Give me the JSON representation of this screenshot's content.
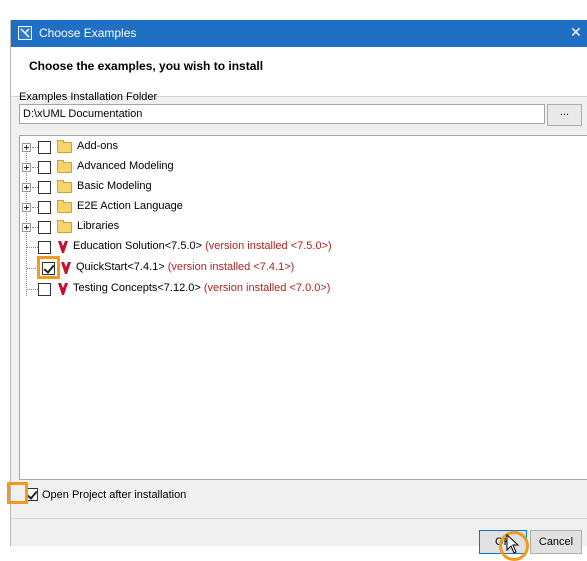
{
  "window": {
    "title": "Choose Examples",
    "close_glyph": "✕",
    "heading": "Choose the examples, you wish to install"
  },
  "folder": {
    "label": "Examples Installation Folder",
    "value": "D:\\xUML Documentation",
    "browse_label": "..."
  },
  "tree": {
    "items": [
      {
        "label": "Add-ons",
        "type": "folder",
        "checked": false,
        "expandable": true
      },
      {
        "label": "Advanced Modeling",
        "type": "folder",
        "checked": false,
        "expandable": true
      },
      {
        "label": "Basic Modeling",
        "type": "folder",
        "checked": false,
        "expandable": true
      },
      {
        "label": "E2E Action Language",
        "type": "folder",
        "checked": false,
        "expandable": true
      },
      {
        "label": "Libraries",
        "type": "folder",
        "checked": false,
        "expandable": true
      },
      {
        "label": "Education Solution<7.5.0>",
        "version": "(version installed <7.5.0>)",
        "type": "model",
        "checked": false,
        "expandable": false
      },
      {
        "label": "QuickStart<7.4.1>",
        "version": "(version installed <7.4.1>)",
        "type": "model",
        "checked": true,
        "expandable": false
      },
      {
        "label": "Testing Concepts<7.12.0>",
        "version": "(version installed <7.0.0>)",
        "type": "model",
        "checked": false,
        "expandable": false
      }
    ]
  },
  "open_project": {
    "label": "Open Project after installation",
    "checked": true
  },
  "buttons": {
    "ok_label": "OK",
    "cancel_label": "Cancel"
  },
  "colors": {
    "titlebar": "#1f6fc5",
    "highlight": "#f39a1e",
    "version_text": "#b22222",
    "folder_icon": "#f5d56a",
    "model_icon": "#c8102e"
  },
  "icons": {
    "folder": "folder-icon",
    "model": "model-icon",
    "expand": "plus-expander-icon",
    "app": "app-icon",
    "close": "close-icon"
  }
}
